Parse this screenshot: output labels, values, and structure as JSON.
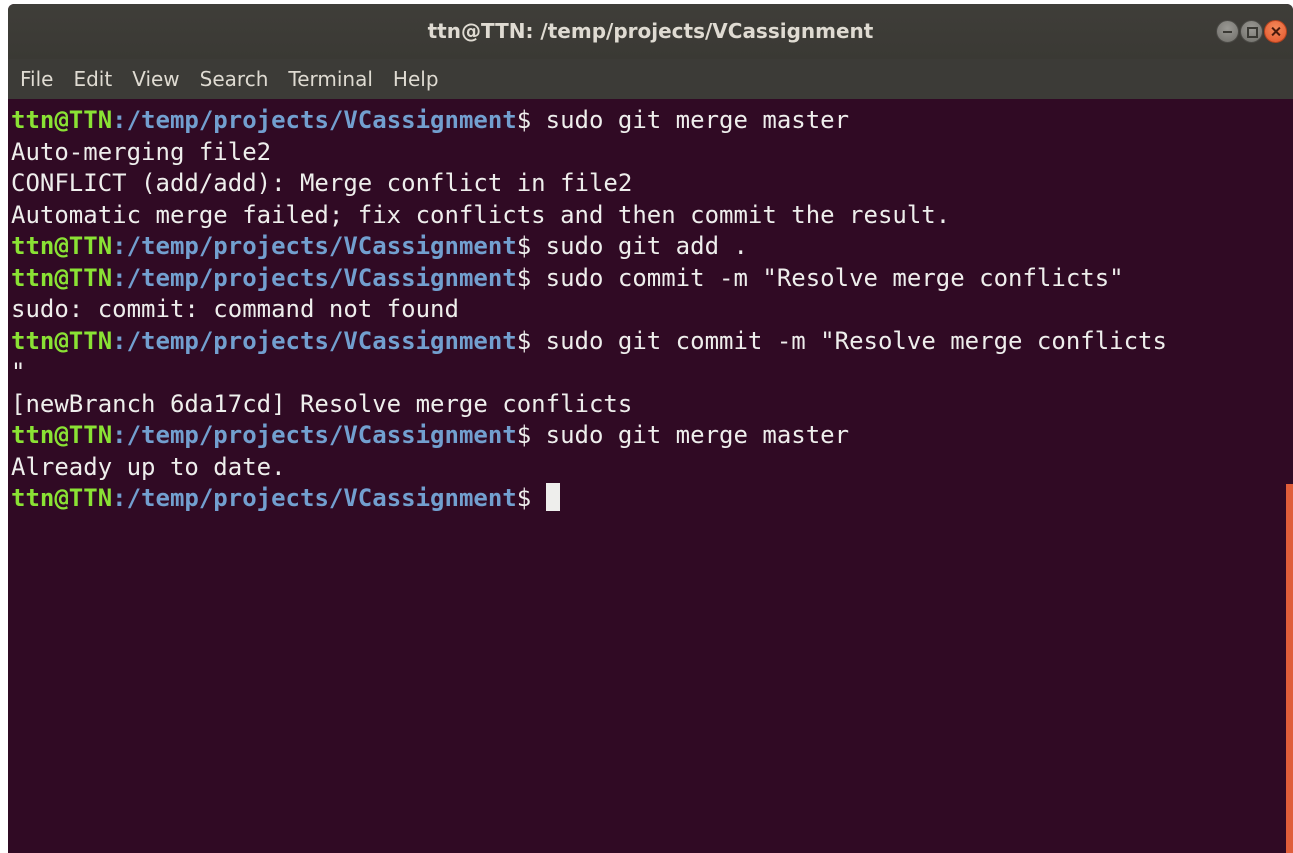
{
  "window": {
    "title": "ttn@TTN: /temp/projects/VCassignment"
  },
  "menu": [
    "File",
    "Edit",
    "View",
    "Search",
    "Terminal",
    "Help"
  ],
  "terminal": {
    "prompt_user": "ttn@TTN",
    "prompt_path": ":/temp/projects/VCassignment",
    "prompt_symbol": "$ ",
    "lines": [
      {
        "type": "cmd",
        "text": "sudo git merge master"
      },
      {
        "type": "out",
        "text": "Auto-merging file2"
      },
      {
        "type": "out",
        "text": "CONFLICT (add/add): Merge conflict in file2"
      },
      {
        "type": "out",
        "text": "Automatic merge failed; fix conflicts and then commit the result."
      },
      {
        "type": "cmd",
        "text": "sudo git add ."
      },
      {
        "type": "cmd",
        "text": "sudo commit -m \"Resolve merge conflicts\""
      },
      {
        "type": "out",
        "text": "sudo: commit: command not found"
      },
      {
        "type": "cmd",
        "text": "sudo git commit -m \"Resolve merge conflicts"
      },
      {
        "type": "out",
        "text": "\""
      },
      {
        "type": "out",
        "text": "[newBranch 6da17cd] Resolve merge conflicts"
      },
      {
        "type": "cmd",
        "text": "sudo git merge master"
      },
      {
        "type": "out",
        "text": "Already up to date."
      },
      {
        "type": "prompt",
        "text": ""
      }
    ]
  },
  "colors": {
    "background": "#300a24",
    "prompt_user": "#8ae234",
    "prompt_path": "#729fcf",
    "text": "#eeeeec",
    "scrollbar": "#e05e3a"
  }
}
